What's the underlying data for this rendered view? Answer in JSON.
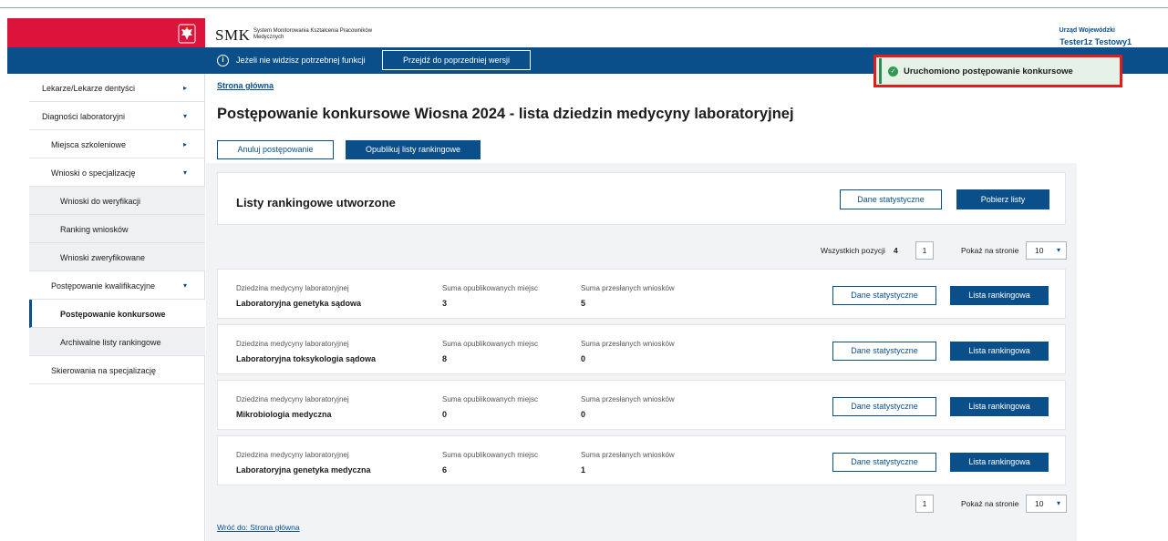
{
  "header": {
    "app_abbr": "SMK",
    "app_name": "System Monitorowania Kształcenia Pracowników Medycznych",
    "user_role": "Urząd Wojewódzki",
    "user_name": "Tester1z Testowy1"
  },
  "bluebar": {
    "info_text": "Jeżeli nie widzisz potrzebnej funkcji",
    "prev_version_label": "Przejdź do poprzedniej wersji"
  },
  "toast": {
    "message": "Uruchomiono postępowanie konkursowe",
    "color": "#2e9b4e",
    "highlight_color": "#e21b1b"
  },
  "sidebar": {
    "items": [
      {
        "label": "Lekarze/Lekarze dentyści",
        "arrow": "▸"
      },
      {
        "label": "Diagności laboratoryjni",
        "arrow": "▾"
      },
      {
        "label": "Miejsca szkoleniowe",
        "arrow": "▸"
      },
      {
        "label": "Wnioski o specjalizację",
        "arrow": "▾"
      },
      {
        "label": "Wnioski do weryfikacji"
      },
      {
        "label": "Ranking wniosków"
      },
      {
        "label": "Wnioski zweryfikowane"
      },
      {
        "label": "Postępowanie kwalifikacyjne",
        "arrow": "▾"
      },
      {
        "label": "Postępowanie konkursowe"
      },
      {
        "label": "Archiwalne listy rankingowe"
      },
      {
        "label": "Skierowania na specjalizację"
      }
    ]
  },
  "main": {
    "breadcrumb": "Strona główna",
    "title": "Postępowanie konkursowe Wiosna 2024 - lista dziedzin medycyny laboratoryjnej",
    "cancel_label": "Anuluj postępowanie",
    "publish_label": "Opublikuj listy rankingowe",
    "lists_title": "Listy rankingowe utworzone",
    "stats_label": "Dane statystyczne",
    "download_label": "Pobierz listy",
    "total_label": "Wszystkich pozycji",
    "total_value": "4",
    "page_value": "1",
    "per_page_label": "Pokaż na stronie",
    "per_page_value": "10",
    "back_link": "Wróć do: Strona główna"
  },
  "table": {
    "col_field": "Dziedzina medycyny laboratoryjnej",
    "col_published": "Suma opublikowanych miejsc",
    "col_submitted": "Suma przesłanych wniosków",
    "stats_label": "Dane statystyczne",
    "ranking_label": "Lista rankingowa",
    "rows": [
      {
        "field": "Laboratoryjna genetyka sądowa",
        "published": "3",
        "submitted": "5"
      },
      {
        "field": "Laboratoryjna toksykologia sądowa",
        "published": "8",
        "submitted": "0"
      },
      {
        "field": "Mikrobiologia medyczna",
        "published": "0",
        "submitted": "0"
      },
      {
        "field": "Laboratoryjna genetyka medyczna",
        "published": "6",
        "submitted": "1"
      }
    ]
  },
  "colors": {
    "primary": "#0a4f8a",
    "brand_red": "#dc143c"
  }
}
